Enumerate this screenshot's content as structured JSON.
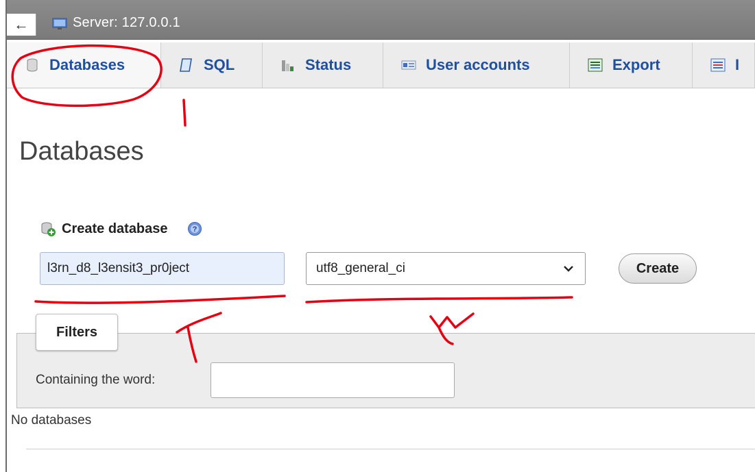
{
  "server_bar": {
    "back_glyph": "←",
    "label": "Server: 127.0.0.1"
  },
  "tabs": [
    {
      "label": "Databases",
      "icon": "database-icon",
      "active": true
    },
    {
      "label": "SQL",
      "icon": "sql-icon"
    },
    {
      "label": "Status",
      "icon": "status-chart-icon"
    },
    {
      "label": "User accounts",
      "icon": "user-accounts-icon"
    },
    {
      "label": "Export",
      "icon": "export-icon"
    },
    {
      "label": "I",
      "icon": "import-icon"
    }
  ],
  "page": {
    "title": "Databases"
  },
  "create_db": {
    "heading": "Create database",
    "name_value": "l3rn_d8_l3ensit3_pr0ject",
    "collation_selected": "utf8_general_ci",
    "create_label": "Create"
  },
  "filters": {
    "legend": "Filters",
    "label": "Containing the word:",
    "value": ""
  },
  "empty_state": "No databases",
  "annotations": {
    "stroke_color": "#e60012"
  }
}
